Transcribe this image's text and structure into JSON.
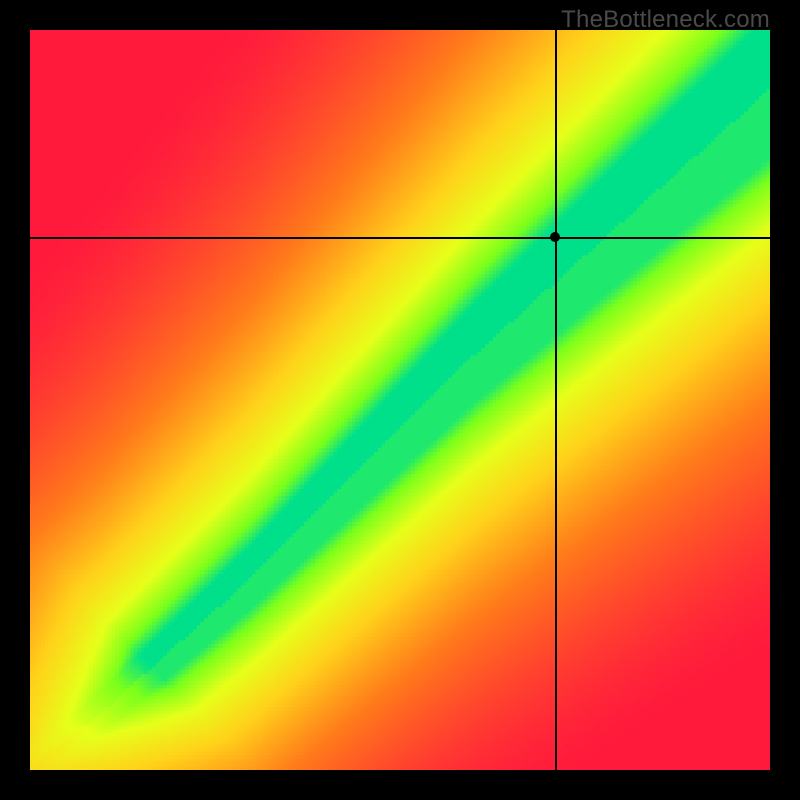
{
  "watermark": "TheBottleneck.com",
  "chart_data": {
    "type": "heatmap",
    "title": "",
    "xlabel": "",
    "ylabel": "",
    "xlim": [
      0,
      100
    ],
    "ylim": [
      0,
      100
    ],
    "grid": false,
    "legend": false,
    "marker": {
      "x": 71,
      "y": 72,
      "note": "crosshair intersection point"
    },
    "optimal_band": {
      "description": "Diagonal green band where values are balanced; bottleneck magnitude increases away from the band.",
      "center_line_samples": [
        {
          "x": 0,
          "y": 0
        },
        {
          "x": 10,
          "y": 8
        },
        {
          "x": 20,
          "y": 17
        },
        {
          "x": 30,
          "y": 26
        },
        {
          "x": 40,
          "y": 36
        },
        {
          "x": 50,
          "y": 46
        },
        {
          "x": 60,
          "y": 56
        },
        {
          "x": 70,
          "y": 65
        },
        {
          "x": 80,
          "y": 74
        },
        {
          "x": 90,
          "y": 83
        },
        {
          "x": 100,
          "y": 92
        }
      ],
      "band_half_width_percent_at_start": 2,
      "band_half_width_percent_at_end": 10
    },
    "color_scale": [
      {
        "value": 0.0,
        "color": "#ff1a3c",
        "meaning": "severe bottleneck"
      },
      {
        "value": 0.35,
        "color": "#ff7a1a",
        "meaning": "high bottleneck"
      },
      {
        "value": 0.6,
        "color": "#ffd21a",
        "meaning": "moderate"
      },
      {
        "value": 0.78,
        "color": "#e6ff1a",
        "meaning": "mild"
      },
      {
        "value": 0.92,
        "color": "#7aff1a",
        "meaning": "near optimal"
      },
      {
        "value": 1.0,
        "color": "#00e08a",
        "meaning": "optimal"
      }
    ]
  }
}
